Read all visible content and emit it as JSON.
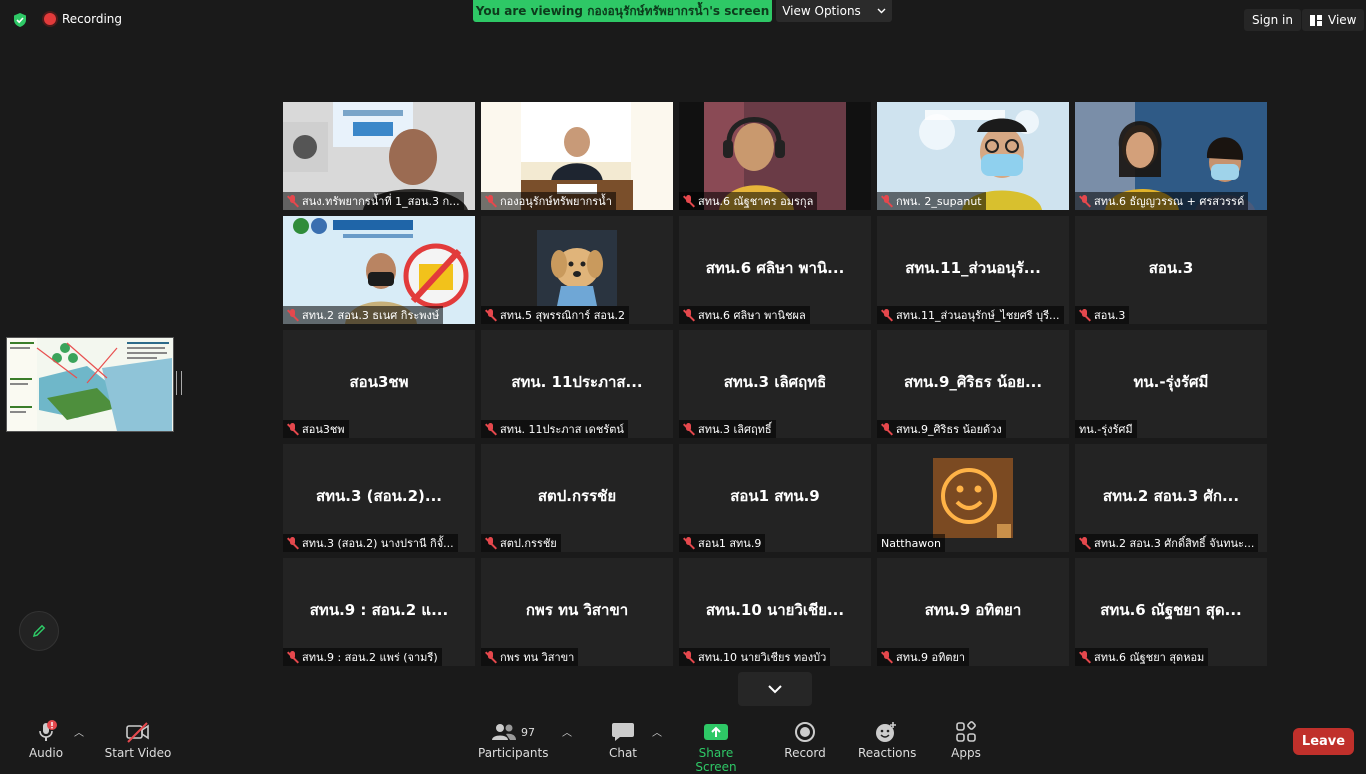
{
  "topbar": {
    "recording_label": "Recording",
    "viewing_banner": "You are viewing กองอนุรักษ์ทรัพยากรน้ำ's screen",
    "view_options_label": "View Options",
    "sign_in_label": "Sign in",
    "view_label": "View"
  },
  "tiles": [
    {
      "label": "สนง.ทรัพยากรน้ำที่ 1_สอน.3 ก...",
      "center": "",
      "video": "man-office"
    },
    {
      "label": "กองอนุรักษ์ทรัพยากรน้ำ",
      "center": "",
      "video": "man-desk"
    },
    {
      "label": "สทน.6 ณัฐชาคร อมรกุล",
      "center": "",
      "video": "man-headset"
    },
    {
      "label": "กพน. 2_supanut",
      "center": "",
      "video": "man-mask"
    },
    {
      "label": "สทน.6 ธัญญวรรณ + ศรสวรรค์",
      "center": "",
      "video": "two-women"
    },
    {
      "label": "สทน.2 สอน.3 ธเนศ กิระพงษ์",
      "center": "",
      "video": "officer"
    },
    {
      "label": "สทน.5 สุพรรณิการ์ สอน.2",
      "center": "",
      "video": "dog"
    },
    {
      "label": "สทน.6 ศลิษา พานิชผล",
      "center": "สทน.6 ศลิษา พานิ...",
      "video": ""
    },
    {
      "label": "สทน.11_ส่วนอนุรักษ์_ไชยศรี บุรี...",
      "center": "สทน.11_ส่วนอนุรั...",
      "video": ""
    },
    {
      "label": "สอน.3",
      "center": "สอน.3",
      "video": ""
    },
    {
      "label": "สอน3ชพ",
      "center": "สอน3ชพ",
      "video": ""
    },
    {
      "label": "สทน. 11ประภาส เดชรัตน์",
      "center": "สทน. 11ประภาส...",
      "video": ""
    },
    {
      "label": "สทน.3 เลิศฤทธิ์",
      "center": "สทน.3 เลิศฤทธิ",
      "video": ""
    },
    {
      "label": "สทน.9_ศิริธร น้อยด้วง",
      "center": "สทน.9_ศิริธร น้อย...",
      "video": ""
    },
    {
      "label": "ทน.-รุ่งรัศมี",
      "center": "ทน.-รุ่งรัศมี",
      "video": "",
      "no_mic": true
    },
    {
      "label": "สทน.3 (สอน.2)  นางปรานี  กิจั้...",
      "center": "สทน.3 (สอน.2)...",
      "video": ""
    },
    {
      "label": "สตป.กรรชัย",
      "center": "สตป.กรรชัย",
      "video": ""
    },
    {
      "label": "สอน1 สทน.9",
      "center": "สอน1 สทน.9",
      "video": ""
    },
    {
      "label": "Natthawon",
      "center": "",
      "video": "smiley",
      "no_mic": true
    },
    {
      "label": "สทน.2 สอน.3 ศักดิ์สิทธิ์ จันทนะ...",
      "center": "สทน.2 สอน.3 ศัก...",
      "video": ""
    },
    {
      "label": "สทน.9 : สอน.2 แพร่ (จามรี)",
      "center": "สทน.9 : สอน.2 แ...",
      "video": ""
    },
    {
      "label": "กพร ทน วิสาขา",
      "center": "กพร ทน วิสาขา",
      "video": ""
    },
    {
      "label": "สทน.10 นายวิเชียร  ทองบัว",
      "center": "สทน.10 นายวิเชีย...",
      "video": ""
    },
    {
      "label": "สทน.9 อทิตยา",
      "center": "สทน.9 อทิตยา",
      "video": ""
    },
    {
      "label": "สทน.6 ณัฐชยา สุดหอม",
      "center": "สทน.6 ณัฐชยา สุด...",
      "video": ""
    }
  ],
  "toolbar": {
    "audio": "Audio",
    "start_video": "Start Video",
    "participants": "Participants",
    "participants_count": "97",
    "chat": "Chat",
    "share_screen": "Share Screen",
    "record": "Record",
    "reactions": "Reactions",
    "apps": "Apps",
    "leave": "Leave"
  },
  "colors": {
    "accent_green": "#2ec866",
    "active_speaker": "#d8e94c",
    "leave_red": "#c0302b",
    "muted_red": "#e5484d"
  }
}
